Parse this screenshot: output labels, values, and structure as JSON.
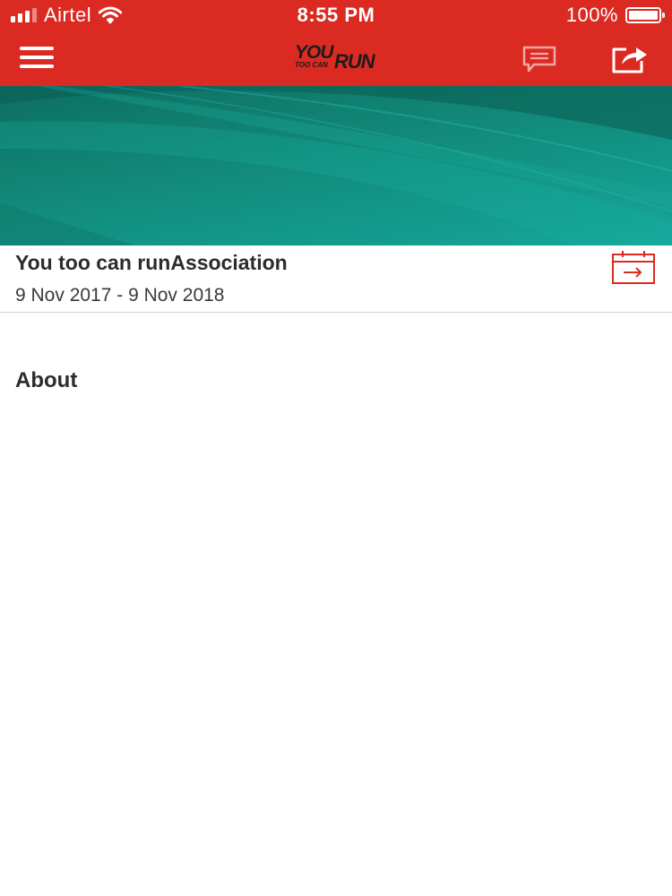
{
  "status_bar": {
    "carrier": "Airtel",
    "time": "8:55 PM",
    "battery": "100%"
  },
  "header": {
    "logo": {
      "line1": "YOU",
      "line2": "TOO CAN",
      "line3": "RUN"
    },
    "icons": [
      "hamburger-menu-icon",
      "chat-bubble-icon",
      "share-icon"
    ],
    "color": "#db2a22"
  },
  "event": {
    "title": "You too can runAssociation",
    "dates": "9 Nov 2017 - 9 Nov 2018",
    "calendar_icon": "calendar-add-icon"
  },
  "about": {
    "heading": "About"
  },
  "colors": {
    "accent": "#db2a22",
    "banner_teal": "#128a7b"
  }
}
